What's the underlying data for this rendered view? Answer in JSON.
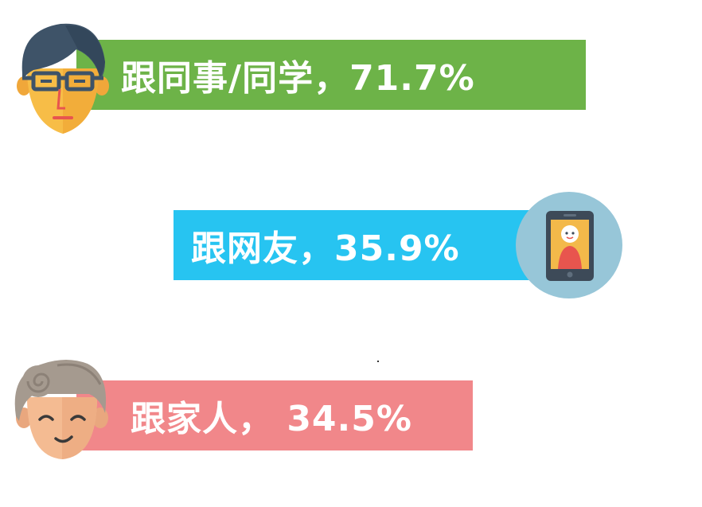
{
  "chart_data": {
    "type": "bar",
    "categories": [
      "跟同事/同学",
      "跟网友",
      "跟家人"
    ],
    "values": [
      71.7,
      35.9,
      34.5
    ],
    "unit": "%",
    "labels": [
      "跟同事/同学，71.7%",
      "跟网友，35.9%",
      "跟家人， 34.5%"
    ],
    "colors": [
      "#6db348",
      "#27c4f1",
      "#f1878a"
    ]
  },
  "icons": [
    "coworker-face-with-glasses-icon",
    "smartphone-contact-icon",
    "elderly-family-member-icon"
  ]
}
